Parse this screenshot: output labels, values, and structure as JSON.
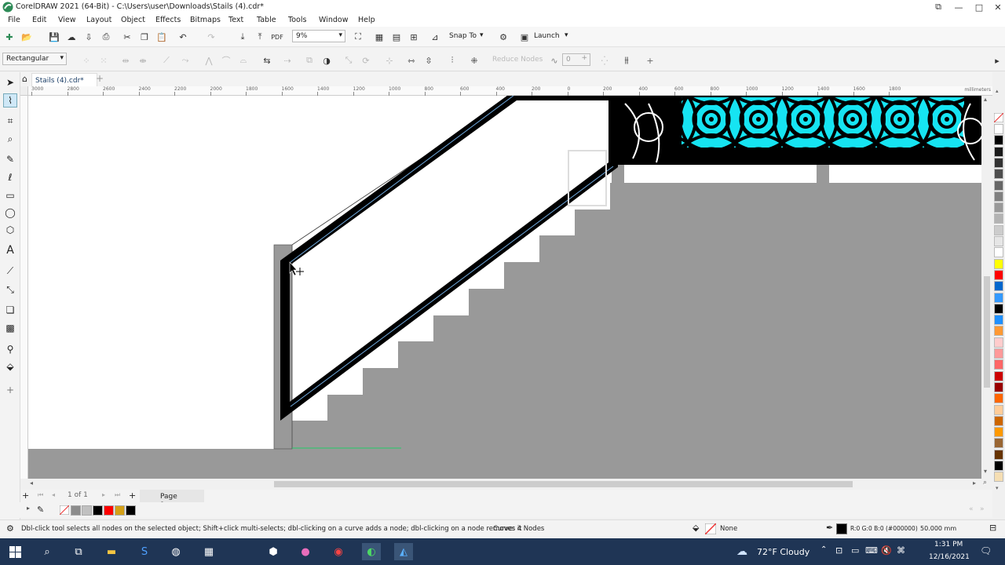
{
  "window": {
    "title": "CorelDRAW 2021 (64-Bit) - C:\\Users\\user\\Downloads\\Stails (4).cdr*"
  },
  "menu": [
    "File",
    "Edit",
    "View",
    "Layout",
    "Object",
    "Effects",
    "Bitmaps",
    "Text",
    "Table",
    "Tools",
    "Window",
    "Help"
  ],
  "standard_toolbar": {
    "zoom_value": "9%",
    "snap_to_label": "Snap To",
    "launch_label": "Launch"
  },
  "property_bar": {
    "selection_mode": "Rectangular",
    "reduce_nodes_label": "Reduce Nodes",
    "smoothness_value": "0"
  },
  "document_tab": {
    "label": "Stails (4).cdr*"
  },
  "ruler": {
    "h_ticks": [
      "3000",
      "2800",
      "2600",
      "2400",
      "2200",
      "2000",
      "1800",
      "1600",
      "1400",
      "1200",
      "1000",
      "800",
      "600",
      "400",
      "200",
      "0",
      "200",
      "400",
      "600",
      "800",
      "1000",
      "1200",
      "1400",
      "1600",
      "1800"
    ],
    "units": "millimeters"
  },
  "page_nav": {
    "counter": "1 of 1",
    "page_tab": "Page 1"
  },
  "status": {
    "hint": "Dbl-click tool selects all nodes on the selected object; Shift+click multi-selects; dbl-clicking on a curve adds a node; dbl-clicking on a node removes it",
    "object_info": "Curve: 4 Nodes",
    "fill_label": "None",
    "outline_color": "R:0 G:0 B:0 (#000000)",
    "outline_width": "50.000 mm"
  },
  "taskbar": {
    "weather": "72°F  Cloudy",
    "time": "1:31 PM",
    "date": "12/16/2021"
  },
  "colors": {
    "accent_green": "#2e8b57",
    "railing_cyan": "#16e4f2",
    "stair_gray": "#999999",
    "palette": [
      "#ffffff",
      "#000000",
      "#1a1a1a",
      "#333333",
      "#4d4d4d",
      "#666666",
      "#808080",
      "#999999",
      "#b3b3b3",
      "#cccccc",
      "#e6e6e6",
      "#ffffff",
      "#ffff00",
      "#ff0000",
      "#0066cc",
      "#3399ff",
      "#000000",
      "#1e90ff",
      "#ff9933",
      "#ffcccc",
      "#ff9999",
      "#ff6666",
      "#cc0000",
      "#990000",
      "#ff6600",
      "#ffcc99",
      "#cc6600",
      "#ff9900",
      "#996633",
      "#663300",
      "#000000",
      "#f5deb3"
    ],
    "doc_palette": [
      "#8c8c8c",
      "#c0c0c0",
      "#000000",
      "#ff0000",
      "#d4a017",
      "#000000"
    ]
  }
}
